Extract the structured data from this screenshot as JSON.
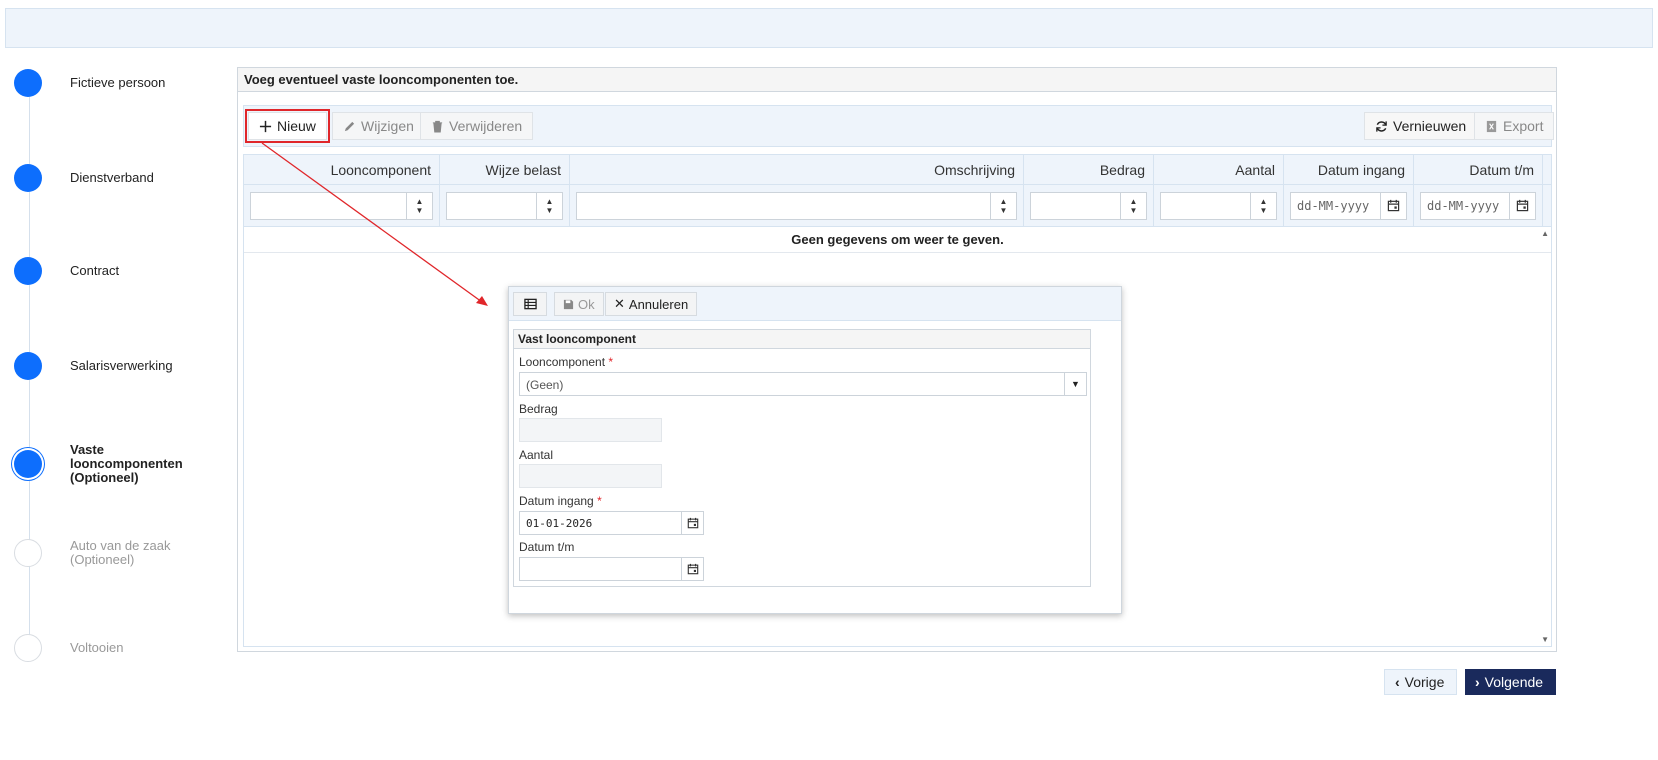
{
  "steps": [
    {
      "label": "Fictieve persoon",
      "state": "done"
    },
    {
      "label": "Dienstverband",
      "state": "done"
    },
    {
      "label": "Contract",
      "state": "done"
    },
    {
      "label": "Salarisverwerking",
      "state": "done"
    },
    {
      "label": "Vaste looncomponenten (Optioneel)",
      "state": "active"
    },
    {
      "label": "Auto van de zaak (Optioneel)",
      "state": "todo"
    },
    {
      "label": "Voltooien",
      "state": "todo"
    }
  ],
  "panel": {
    "title": "Voeg eventueel vaste looncomponenten toe."
  },
  "toolbar": {
    "new_label": "Nieuw",
    "edit_label": "Wijzigen",
    "delete_label": "Verwijderen",
    "refresh_label": "Vernieuwen",
    "export_label": "Export"
  },
  "grid": {
    "columns": [
      "Looncomponent",
      "Wijze belast",
      "Omschrijving",
      "Bedrag",
      "Aantal",
      "Datum ingang",
      "Datum t/m"
    ],
    "date_placeholder": "dd-MM-yyyy",
    "empty_message": "Geen gegevens om weer te geven."
  },
  "popup": {
    "ok_label": "Ok",
    "cancel_label": "Annuleren",
    "section_title": "Vast looncomponent",
    "fields": {
      "looncomponent_label": "Looncomponent",
      "looncomponent_value": "(Geen)",
      "bedrag_label": "Bedrag",
      "aantal_label": "Aantal",
      "datum_ingang_label": "Datum ingang",
      "datum_ingang_value": "01-01-2026",
      "datum_tm_label": "Datum t/m",
      "required_mark": "*"
    }
  },
  "nav": {
    "prev_label": "Vorige",
    "next_label": "Volgende"
  },
  "colors": {
    "accent": "#0d6efd",
    "annotation": "#e0262a",
    "primary_button": "#1a2a5c"
  }
}
